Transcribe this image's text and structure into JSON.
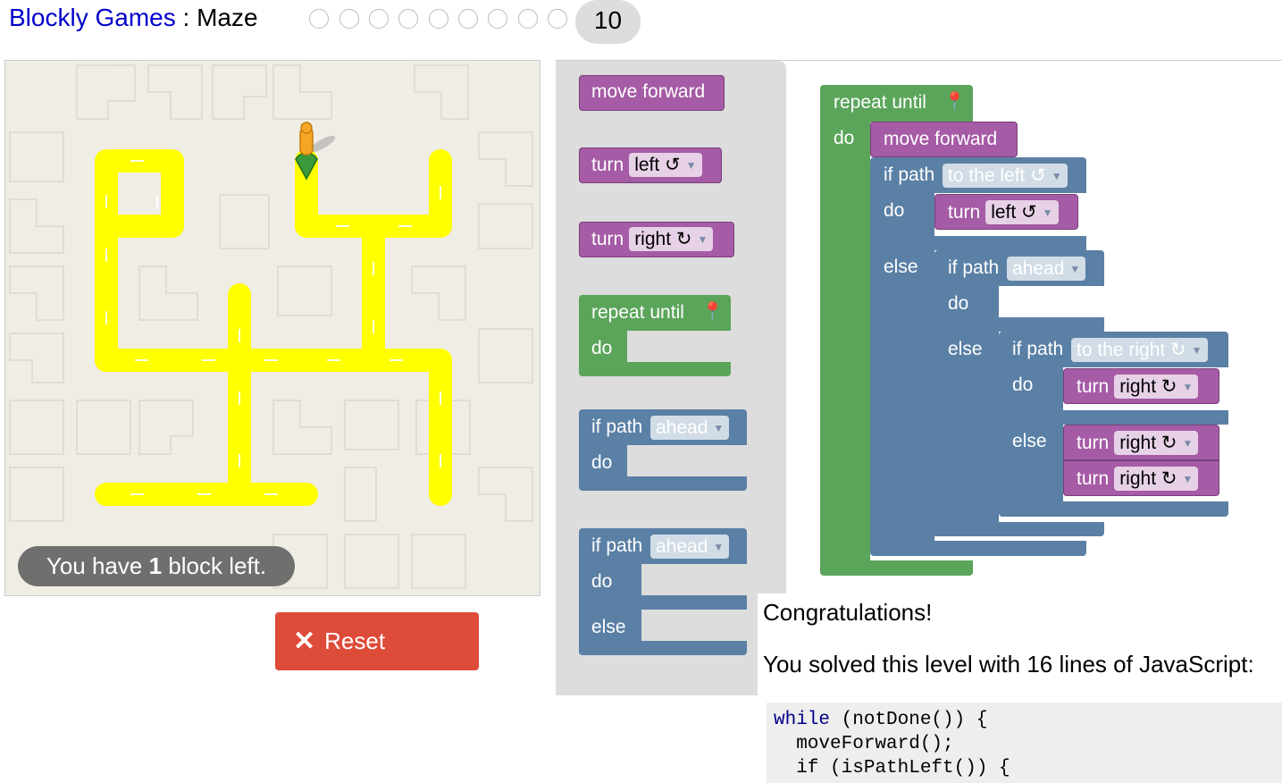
{
  "header": {
    "app_link": "Blockly Games",
    "separator": " : ",
    "game": "Maze",
    "level_count": 9,
    "current_level": "10"
  },
  "maze": {
    "capacity_prefix": "You have ",
    "capacity_count": "1",
    "capacity_suffix": " block left.",
    "reset_label": "Reset",
    "path_color": "#ffff00",
    "wall_color": "#f0ede5"
  },
  "toolbox": {
    "move_forward": "move forward",
    "turn_left_text": "turn",
    "turn_left_dd": "left ↺",
    "turn_right_text": "turn",
    "turn_right_dd": "right ↻",
    "repeat_until": "repeat until",
    "do": "do",
    "if_path": "if path",
    "ahead": "ahead",
    "else": "else"
  },
  "workspace": {
    "repeat_until": "repeat until",
    "do": "do",
    "move_forward": "move forward",
    "if_path": "if path",
    "to_the_left": "to the left ↺",
    "to_the_right": "to the right ↻",
    "ahead": "ahead",
    "turn": "turn",
    "left": "left ↺",
    "right": "right ↻",
    "else": "else"
  },
  "result": {
    "congrats": "Congratulations!",
    "solved": "You solved this level with 16 lines of JavaScript:",
    "code_line1_kw": "while",
    "code_line1_rest": " (notDone()) {",
    "code_line2": "  moveForward();",
    "code_line3": "  if (isPathLeft()) {"
  },
  "colors": {
    "motion": "#a55ba5",
    "loop": "#5ba55b",
    "logic": "#5b80a5",
    "reset": "#dd4b39"
  }
}
